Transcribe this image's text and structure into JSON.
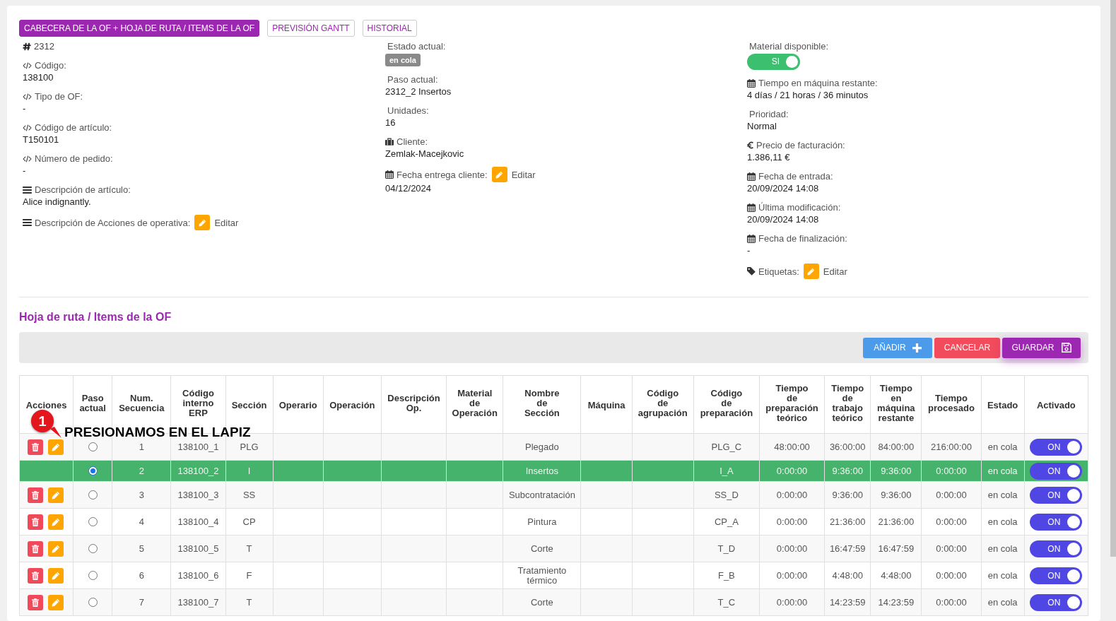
{
  "tabs": [
    {
      "label": "CABECERA DE LA OF + HOJA DE RUTA / ITEMS DE LA OF",
      "selected": true
    },
    {
      "label": "PREVISIÓN GANTT",
      "selected": false
    },
    {
      "label": "HISTORIAL",
      "selected": false
    }
  ],
  "details": [
    [
      {
        "kind": "number",
        "value": "2312"
      },
      {
        "kind": "text",
        "label": "Código:",
        "value": "138100"
      },
      {
        "kind": "text",
        "label": "Tipo de OF:",
        "value": "-"
      },
      {
        "kind": "text",
        "label": "Código de artículo:",
        "value": "T150101"
      },
      {
        "kind": "text",
        "label": "Número de pedido:",
        "value": "-"
      },
      {
        "kind": "text",
        "label": "Descripción de artículo:",
        "value": "Alice indignantly."
      },
      {
        "kind": "edit",
        "label": "Descripción de Acciones de operativa:",
        "action": "Editar"
      }
    ],
    [
      {
        "kind": "badge",
        "label": "Estado actual:",
        "value": "en cola"
      },
      {
        "kind": "text",
        "label": "Paso actual:",
        "value": "2312_2 Insertos"
      },
      {
        "kind": "text",
        "label": "Unidades:",
        "value": "16"
      },
      {
        "kind": "text",
        "label": "Cliente:",
        "value": "Zemlak-Macejkovic"
      },
      {
        "kind": "edit",
        "label": "Fecha entrega cliente:",
        "action": "Editar",
        "value": "04/12/2024"
      }
    ],
    [
      {
        "kind": "toggle",
        "label": "Material disponible:",
        "value": "SI",
        "on": true
      },
      {
        "kind": "text",
        "label": "Tiempo en máquina restante:",
        "value": "4 días / 21 horas / 36 minutos"
      },
      {
        "kind": "text",
        "label": "Prioridad:",
        "value": "Normal"
      },
      {
        "kind": "text",
        "label": "Precio de facturación:",
        "value": "1.386,11 €"
      },
      {
        "kind": "text",
        "label": "Fecha de entrada:",
        "value": "20/09/2024 14:08"
      },
      {
        "kind": "text",
        "label": "Última modificación:",
        "value": "20/09/2024 14:08"
      },
      {
        "kind": "text",
        "label": "Fecha de finalización:",
        "value": "-"
      },
      {
        "kind": "edit",
        "label": "Etiquetas:",
        "action": "Editar"
      }
    ]
  ],
  "routing": {
    "title": "Hoja de ruta / Items de la OF",
    "buttons": [
      {
        "kind": "add",
        "label": "AÑADIR"
      },
      {
        "kind": "cancel",
        "label": "CANCELAR"
      },
      {
        "kind": "save",
        "label": "GUARDAR"
      }
    ],
    "columns": [
      "Acciones",
      "Paso actual",
      "Num. Secuencia",
      "Código interno ERP",
      "Sección",
      "Operario",
      "Operación",
      "Descripción Op.",
      "Material de Operación",
      "Nombre de Sección",
      "Máquina",
      "Código de agrupación",
      "Código de preparación",
      "Tiempo de preparación teórico",
      "Tiempo de trabajo teórico",
      "Tiempo en máquina restante",
      "Tiempo procesado",
      "Estado",
      "Activado"
    ],
    "rows": [
      {
        "selected": false,
        "editable": true,
        "seq": "1",
        "erp_code": "138100_1",
        "section": "PLG",
        "section_name": "Plegado",
        "prep_code": "PLG_C",
        "prep_time": "48:00:00",
        "work_time": "36:00:00",
        "remaining_time": "84:00:00",
        "processed_time": "216:00:00",
        "status": "en cola",
        "active": {
          "label": "ON",
          "on": true
        }
      },
      {
        "selected": true,
        "editable": false,
        "seq": "2",
        "erp_code": "138100_2",
        "section": "I",
        "section_name": "Insertos",
        "prep_code": "I_A",
        "prep_time": "0:00:00",
        "work_time": "9:36:00",
        "remaining_time": "9:36:00",
        "processed_time": "0:00:00",
        "status": "en cola",
        "active": {
          "label": "ON",
          "on": true
        }
      },
      {
        "selected": false,
        "editable": true,
        "seq": "3",
        "erp_code": "138100_3",
        "section": "SS",
        "section_name": "Subcontratación",
        "prep_code": "SS_D",
        "prep_time": "0:00:00",
        "work_time": "9:36:00",
        "remaining_time": "9:36:00",
        "processed_time": "0:00:00",
        "status": "en cola",
        "active": {
          "label": "ON",
          "on": true
        }
      },
      {
        "selected": false,
        "editable": true,
        "seq": "4",
        "erp_code": "138100_4",
        "section": "CP",
        "section_name": "Pintura",
        "prep_code": "CP_A",
        "prep_time": "0:00:00",
        "work_time": "21:36:00",
        "remaining_time": "21:36:00",
        "processed_time": "0:00:00",
        "status": "en cola",
        "active": {
          "label": "ON",
          "on": true
        }
      },
      {
        "selected": false,
        "editable": true,
        "seq": "5",
        "erp_code": "138100_5",
        "section": "T",
        "section_name": "Corte",
        "prep_code": "T_D",
        "prep_time": "0:00:00",
        "work_time": "16:47:59",
        "remaining_time": "16:47:59",
        "processed_time": "0:00:00",
        "status": "en cola",
        "active": {
          "label": "ON",
          "on": true
        }
      },
      {
        "selected": false,
        "editable": true,
        "seq": "6",
        "erp_code": "138100_6",
        "section": "F",
        "section_name": "Tratamiento térmico",
        "prep_code": "F_B",
        "prep_time": "0:00:00",
        "work_time": "4:48:00",
        "remaining_time": "4:48:00",
        "processed_time": "0:00:00",
        "status": "en cola",
        "active": {
          "label": "ON",
          "on": true
        }
      },
      {
        "selected": false,
        "editable": true,
        "seq": "7",
        "erp_code": "138100_7",
        "section": "T",
        "section_name": "Corte",
        "prep_code": "T_C",
        "prep_time": "0:00:00",
        "work_time": "14:23:59",
        "remaining_time": "14:23:59",
        "processed_time": "0:00:00",
        "status": "en cola",
        "active": {
          "label": "ON",
          "on": true
        }
      }
    ]
  },
  "annotation": {
    "number": "1",
    "text": "PRESIONAMOS EN EL LAPIZ"
  }
}
